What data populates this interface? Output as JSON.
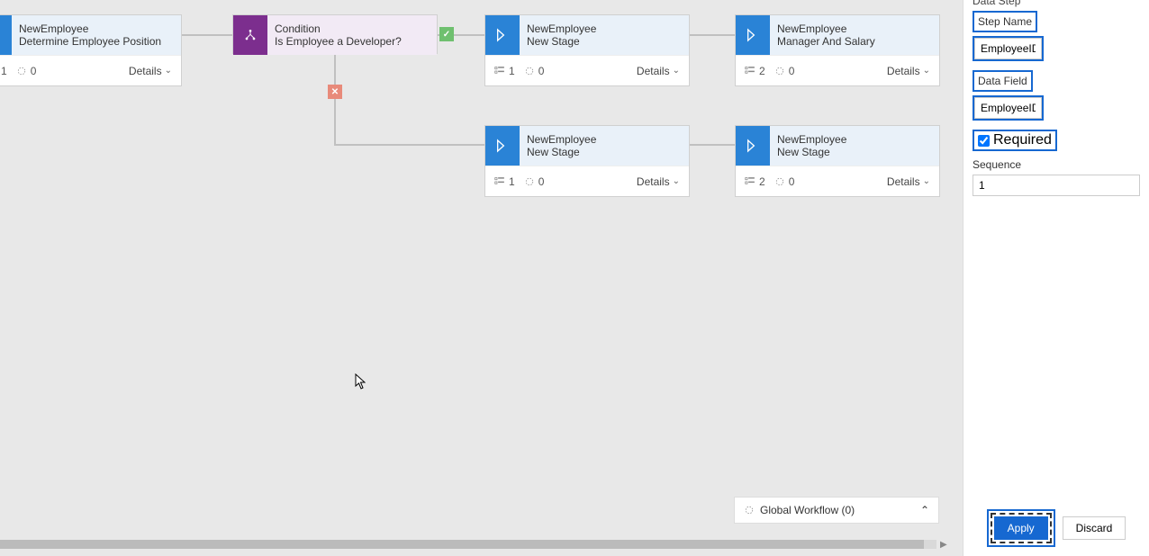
{
  "nodes": {
    "n1": {
      "title": "NewEmployee",
      "subtitle": "Determine Employee Position",
      "m1": "1",
      "m2": "0",
      "details": "Details"
    },
    "cond": {
      "title": "Condition",
      "subtitle": "Is Employee a Developer?"
    },
    "n2": {
      "title": "NewEmployee",
      "subtitle": "New Stage",
      "m1": "1",
      "m2": "0",
      "details": "Details"
    },
    "n3": {
      "title": "NewEmployee",
      "subtitle": "Manager And Salary",
      "m1": "2",
      "m2": "0",
      "details": "Details"
    },
    "n4": {
      "title": "NewEmployee",
      "subtitle": "New Stage",
      "m1": "1",
      "m2": "0",
      "details": "Details"
    },
    "n5": {
      "title": "NewEmployee",
      "subtitle": "New Stage",
      "m1": "2",
      "m2": "0",
      "details": "Details"
    }
  },
  "globalWorkflow": "Global Workflow (0)",
  "panel": {
    "header": "Data Step",
    "stepNameLabel": "Step Name",
    "stepNameValue": "EmployeeID",
    "dataFieldLabel": "Data Field",
    "dataFieldValue": "EmployeeID",
    "requiredLabel": "Required",
    "sequenceLabel": "Sequence",
    "sequenceValue": "1",
    "apply": "Apply",
    "discard": "Discard"
  }
}
